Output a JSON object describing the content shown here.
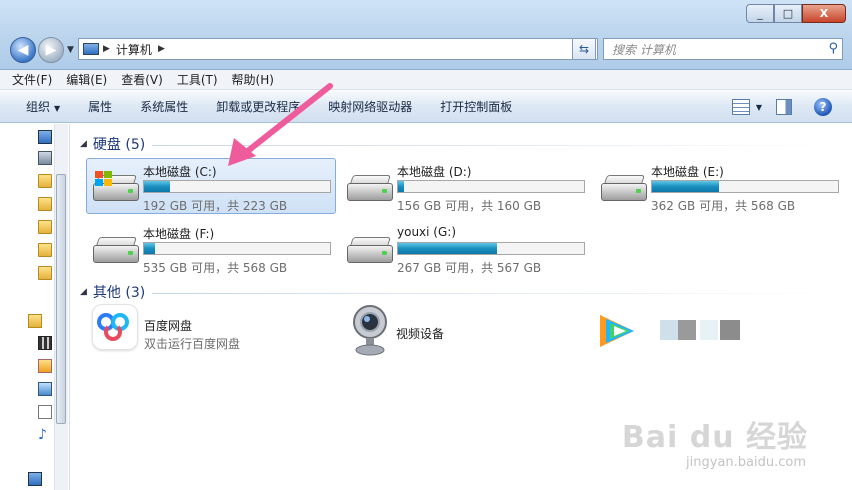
{
  "window": {
    "minimize": "_",
    "maximize": "□",
    "close": "X"
  },
  "address": {
    "location": "计算机",
    "search_placeholder": "搜索 计算机"
  },
  "menu": [
    "文件(F)",
    "编辑(E)",
    "查看(V)",
    "工具(T)",
    "帮助(H)"
  ],
  "toolbar": {
    "organize": "组织",
    "properties": "属性",
    "system_properties": "系统属性",
    "uninstall": "卸载或更改程序",
    "map_drive": "映射网络驱动器",
    "control_panel": "打开控制面板"
  },
  "groups": {
    "hard_disks": "硬盘 (5)",
    "other": "其他 (3)"
  },
  "drives": [
    {
      "name": "本地磁盘 (C:)",
      "free": "192 GB 可用，共 223 GB",
      "used_fraction": 0.14,
      "selected": true,
      "system": true
    },
    {
      "name": "本地磁盘 (D:)",
      "free": "156 GB 可用，共 160 GB",
      "used_fraction": 0.03,
      "selected": false,
      "system": false
    },
    {
      "name": "本地磁盘 (E:)",
      "free": "362 GB 可用，共 568 GB",
      "used_fraction": 0.36,
      "selected": false,
      "system": false
    },
    {
      "name": "本地磁盘 (F:)",
      "free": "535 GB 可用，共 568 GB",
      "used_fraction": 0.06,
      "selected": false,
      "system": false
    },
    {
      "name": "youxi (G:)",
      "free": "267 GB 可用，共 567 GB",
      "used_fraction": 0.53,
      "selected": false,
      "system": false
    }
  ],
  "others": [
    {
      "name": "百度网盘",
      "desc": "双击运行百度网盘"
    },
    {
      "name": "视频设备",
      "desc": ""
    }
  ],
  "watermark": {
    "brand": "Bai du 经验",
    "url": "jingyan.baidu.com"
  },
  "colors": {
    "accent_arrow": "#ef5c9c",
    "bar_fill": "#1a8fbf",
    "group_header": "#1e3a7a"
  }
}
